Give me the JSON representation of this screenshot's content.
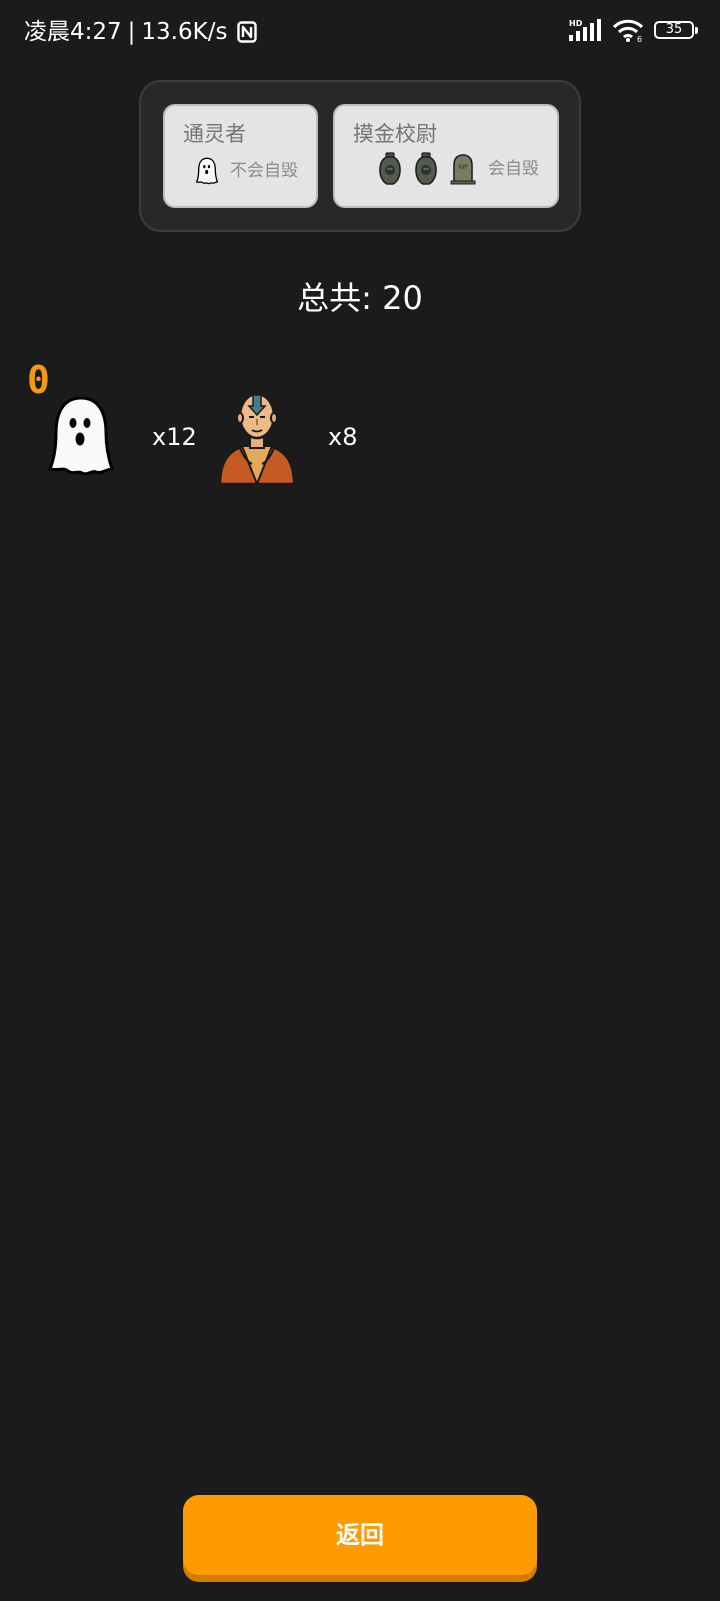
{
  "status_bar": {
    "time": "凌晨4:27",
    "separator": "|",
    "net_speed": "13.6K/s",
    "network_badge": "HD",
    "wifi_sub": "6",
    "battery_level": "35",
    "icons": [
      "nfc-icon",
      "hd-signal-icon",
      "wifi-icon",
      "battery-icon"
    ]
  },
  "rules": {
    "cards": [
      {
        "title": "通灵者",
        "icons": [
          "ghost-icon"
        ],
        "description": "不会自毁"
      },
      {
        "title": "摸金校尉",
        "icons": [
          "urn-icon",
          "urn-icon",
          "tombstone-icon"
        ],
        "tombstone_text": "RIP",
        "description": "会自毁"
      }
    ]
  },
  "summary": {
    "total_label": "总共: 20"
  },
  "roles": {
    "score": "0",
    "items": [
      {
        "icon": "ghost-icon",
        "count": "x12"
      },
      {
        "icon": "monk-icon",
        "count": "x8"
      }
    ]
  },
  "actions": {
    "back_label": "返回"
  },
  "colors": {
    "background": "#1b1b1b",
    "accent": "#ff9a00",
    "score": "#f39a13",
    "card": "#e4e4e4",
    "panel": "#282828"
  }
}
